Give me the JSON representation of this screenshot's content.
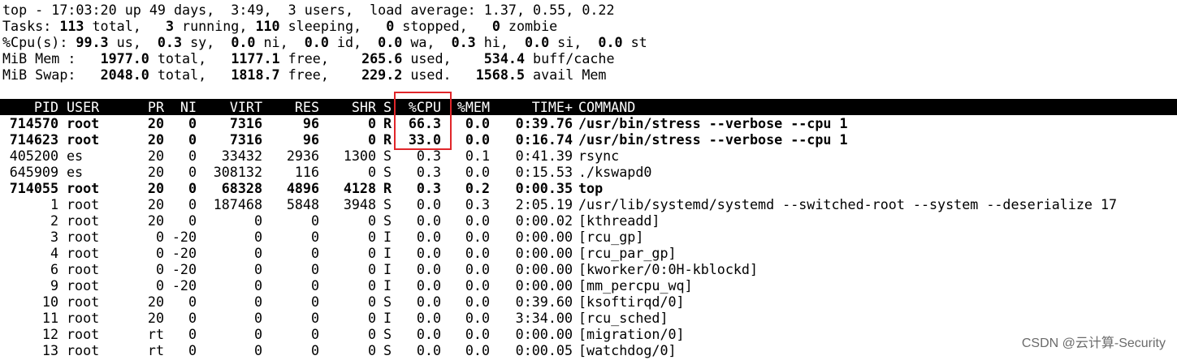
{
  "summary": {
    "line1": {
      "prefix": "top - 17:03:20 up 49 days,  3:49,  3 users,  load average: 1.37, 0.55, 0.22"
    },
    "tasks": {
      "label": "Tasks: ",
      "total": "113",
      "total_label": " total,   ",
      "running": "3",
      "running_label": " running, ",
      "sleeping": "110",
      "sleeping_label": " sleeping,   ",
      "stopped": "0",
      "stopped_label": " stopped,   ",
      "zombie": "0",
      "zombie_label": " zombie"
    },
    "cpu": {
      "label": "%Cpu(s): ",
      "us": "99.3",
      "us_label": " us,  ",
      "sy": "0.3",
      "sy_label": " sy,  ",
      "ni": "0.0",
      "ni_label": " ni,  ",
      "id": "0.0",
      "id_label": " id,  ",
      "wa": "0.0",
      "wa_label": " wa,  ",
      "hi": "0.3",
      "hi_label": " hi,  ",
      "si": "0.0",
      "si_label": " si,  ",
      "st": "0.0",
      "st_label": " st"
    },
    "mem": {
      "label": "MiB Mem :   ",
      "total": "1977.0",
      "total_label": " total,   ",
      "free": "1177.1",
      "free_label": " free,    ",
      "used": "265.6",
      "used_label": " used,    ",
      "buff": "534.4",
      "buff_label": " buff/cache"
    },
    "swap": {
      "label": "MiB Swap:   ",
      "total": "2048.0",
      "total_label": " total,   ",
      "free": "1818.7",
      "free_label": " free,    ",
      "used": "229.2",
      "used_label": " used.   ",
      "avail": "1568.5",
      "avail_label": " avail Mem"
    }
  },
  "table": {
    "headers": [
      "PID",
      "USER",
      "PR",
      "NI",
      "VIRT",
      "RES",
      "SHR",
      "S",
      "%CPU",
      "%MEM",
      "TIME+",
      "COMMAND"
    ],
    "rows": [
      {
        "bold": true,
        "cells": [
          "714570",
          "root",
          "20",
          "0",
          "7316",
          "96",
          "0",
          "R",
          "66.3",
          "0.0",
          "0:39.76",
          "/usr/bin/stress --verbose --cpu 1"
        ]
      },
      {
        "bold": true,
        "cells": [
          "714623",
          "root",
          "20",
          "0",
          "7316",
          "96",
          "0",
          "R",
          "33.0",
          "0.0",
          "0:16.74",
          "/usr/bin/stress --verbose --cpu 1"
        ]
      },
      {
        "bold": false,
        "cells": [
          "405200",
          "es",
          "20",
          "0",
          "33432",
          "2936",
          "1300",
          "S",
          "0.3",
          "0.1",
          "0:41.39",
          "rsync"
        ]
      },
      {
        "bold": false,
        "cells": [
          "645909",
          "es",
          "20",
          "0",
          "308132",
          "116",
          "0",
          "S",
          "0.3",
          "0.0",
          "0:15.53",
          "./kswapd0"
        ]
      },
      {
        "bold": true,
        "cells": [
          "714055",
          "root",
          "20",
          "0",
          "68328",
          "4896",
          "4128",
          "R",
          "0.3",
          "0.2",
          "0:00.35",
          "top"
        ]
      },
      {
        "bold": false,
        "cells": [
          "1",
          "root",
          "20",
          "0",
          "187468",
          "5848",
          "3948",
          "S",
          "0.0",
          "0.3",
          "2:05.19",
          "/usr/lib/systemd/systemd --switched-root --system --deserialize 17"
        ]
      },
      {
        "bold": false,
        "cells": [
          "2",
          "root",
          "20",
          "0",
          "0",
          "0",
          "0",
          "S",
          "0.0",
          "0.0",
          "0:00.02",
          "[kthreadd]"
        ]
      },
      {
        "bold": false,
        "cells": [
          "3",
          "root",
          "0",
          "-20",
          "0",
          "0",
          "0",
          "I",
          "0.0",
          "0.0",
          "0:00.00",
          "[rcu_gp]"
        ]
      },
      {
        "bold": false,
        "cells": [
          "4",
          "root",
          "0",
          "-20",
          "0",
          "0",
          "0",
          "I",
          "0.0",
          "0.0",
          "0:00.00",
          "[rcu_par_gp]"
        ]
      },
      {
        "bold": false,
        "cells": [
          "6",
          "root",
          "0",
          "-20",
          "0",
          "0",
          "0",
          "I",
          "0.0",
          "0.0",
          "0:00.00",
          "[kworker/0:0H-kblockd]"
        ]
      },
      {
        "bold": false,
        "cells": [
          "9",
          "root",
          "0",
          "-20",
          "0",
          "0",
          "0",
          "I",
          "0.0",
          "0.0",
          "0:00.00",
          "[mm_percpu_wq]"
        ]
      },
      {
        "bold": false,
        "cells": [
          "10",
          "root",
          "20",
          "0",
          "0",
          "0",
          "0",
          "S",
          "0.0",
          "0.0",
          "0:39.60",
          "[ksoftirqd/0]"
        ]
      },
      {
        "bold": false,
        "cells": [
          "11",
          "root",
          "20",
          "0",
          "0",
          "0",
          "0",
          "I",
          "0.0",
          "0.0",
          "3:34.00",
          "[rcu_sched]"
        ]
      },
      {
        "bold": false,
        "cells": [
          "12",
          "root",
          "rt",
          "0",
          "0",
          "0",
          "0",
          "S",
          "0.0",
          "0.0",
          "0:00.00",
          "[migration/0]"
        ]
      },
      {
        "bold": false,
        "cells": [
          "13",
          "root",
          "rt",
          "0",
          "0",
          "0",
          "0",
          "S",
          "0.0",
          "0.0",
          "0:00.05",
          "[watchdog/0]"
        ]
      }
    ]
  },
  "watermark": "CSDN @云计算-Security",
  "colors": {
    "highlight_box": "#e0262a",
    "header_bg": "#000000",
    "header_fg": "#ffffff"
  }
}
